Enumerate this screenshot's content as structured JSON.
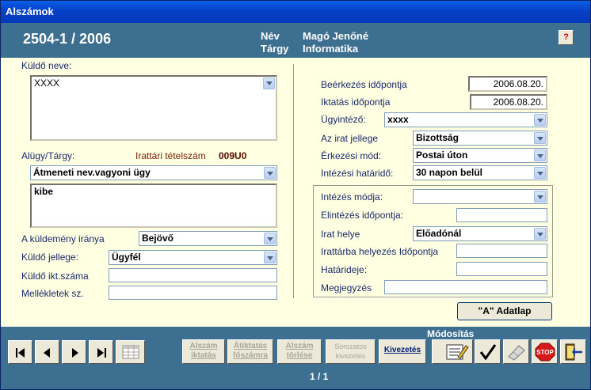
{
  "window": {
    "title": "Alszámok"
  },
  "header": {
    "case_number": "2504-1 / 2006",
    "name_label": "Név",
    "subject_label": "Tárgy",
    "name_value": "Magó Jenőné",
    "subject_value": "Informatika",
    "help_label": "?"
  },
  "left": {
    "sender_name_label": "Küldő neve:",
    "sender_name_value": "XXXX",
    "subject_label": "Alügy/Tárgy:",
    "file_item_label": "Irattári tételszám",
    "file_item_value": "009U0",
    "subject_select": "Átmeneti nev.vagyoni ügy",
    "subject_text": "kibe",
    "direction_label": "A küldemény iránya",
    "direction_value": "Bejövő",
    "sender_type_label": "Küldő jellege:",
    "sender_type_value": "Ügyfél",
    "sender_ref_label": "Küldő ikt.száma",
    "sender_ref_value": "",
    "attachments_label": "Mellékletek sz.",
    "attachments_value": ""
  },
  "right": {
    "arrival_label": "Beérkezés időpontja",
    "arrival_value": "2006.08.20.",
    "filing_label": "Iktatás időpontja",
    "filing_value": "2006.08.20.",
    "clerk_label": "Ügyintéző:",
    "clerk_value": "xxxx",
    "doc_type_label": "Az irat jellege",
    "doc_type_value": "Bizottság",
    "arrival_mode_label": "Érkezési mód:",
    "arrival_mode_value": "Postai úton",
    "deadline_label": "Intézési határidő:",
    "deadline_value": "30 napon belül",
    "handling_mode_label": "Intézés módja:",
    "handling_mode_value": "",
    "completion_label": "Elintézés időpontja:",
    "completion_value": "",
    "location_label": "Irat helye",
    "location_value": "Előadónál",
    "archive_date_label": "Irattárba helyezés Időpontja",
    "archive_date_value": "",
    "due_label": "Határideje:",
    "due_value": "",
    "note_label": "Megjegyzés",
    "note_value": "",
    "adatlap_label": "\"A\" Adatlap"
  },
  "footer": {
    "modification_label": "Módosítás",
    "delete_btn": "Alszám iktatás",
    "refile_btn": "Átiktatás főszámra",
    "remove_btn": "Alszám törlése",
    "serial_btn": "Sorozatos kivezetés",
    "export_btn": "Kivezetés",
    "page_indicator": "1 / 1"
  },
  "icons": [
    "first-record-icon",
    "prev-record-icon",
    "next-record-icon",
    "last-record-icon",
    "grid-icon",
    "edit-form-icon",
    "checkmark-icon",
    "eraser-icon",
    "stop-icon",
    "exit-door-icon"
  ]
}
